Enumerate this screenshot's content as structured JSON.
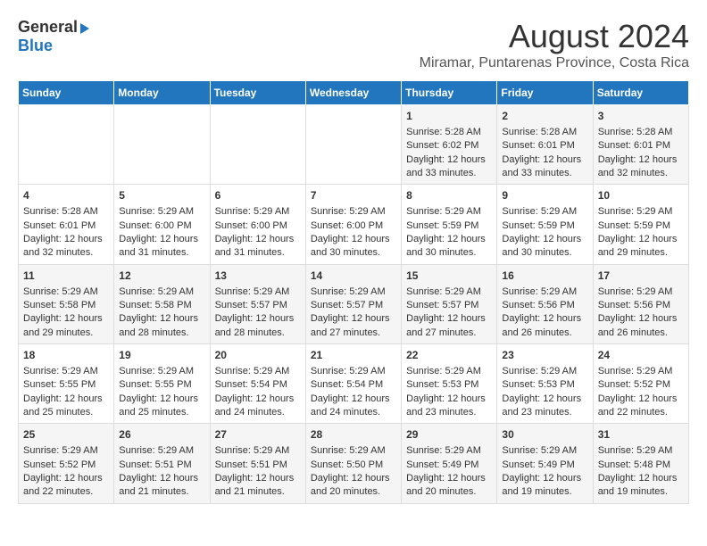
{
  "header": {
    "logo_general": "General",
    "logo_blue": "Blue",
    "month_year": "August 2024",
    "location": "Miramar, Puntarenas Province, Costa Rica"
  },
  "days_of_week": [
    "Sunday",
    "Monday",
    "Tuesday",
    "Wednesday",
    "Thursday",
    "Friday",
    "Saturday"
  ],
  "weeks": [
    [
      {
        "day": "",
        "content": ""
      },
      {
        "day": "",
        "content": ""
      },
      {
        "day": "",
        "content": ""
      },
      {
        "day": "",
        "content": ""
      },
      {
        "day": "1",
        "content": "Sunrise: 5:28 AM\nSunset: 6:02 PM\nDaylight: 12 hours and 33 minutes."
      },
      {
        "day": "2",
        "content": "Sunrise: 5:28 AM\nSunset: 6:01 PM\nDaylight: 12 hours and 33 minutes."
      },
      {
        "day": "3",
        "content": "Sunrise: 5:28 AM\nSunset: 6:01 PM\nDaylight: 12 hours and 32 minutes."
      }
    ],
    [
      {
        "day": "4",
        "content": "Sunrise: 5:28 AM\nSunset: 6:01 PM\nDaylight: 12 hours and 32 minutes."
      },
      {
        "day": "5",
        "content": "Sunrise: 5:29 AM\nSunset: 6:00 PM\nDaylight: 12 hours and 31 minutes."
      },
      {
        "day": "6",
        "content": "Sunrise: 5:29 AM\nSunset: 6:00 PM\nDaylight: 12 hours and 31 minutes."
      },
      {
        "day": "7",
        "content": "Sunrise: 5:29 AM\nSunset: 6:00 PM\nDaylight: 12 hours and 30 minutes."
      },
      {
        "day": "8",
        "content": "Sunrise: 5:29 AM\nSunset: 5:59 PM\nDaylight: 12 hours and 30 minutes."
      },
      {
        "day": "9",
        "content": "Sunrise: 5:29 AM\nSunset: 5:59 PM\nDaylight: 12 hours and 30 minutes."
      },
      {
        "day": "10",
        "content": "Sunrise: 5:29 AM\nSunset: 5:59 PM\nDaylight: 12 hours and 29 minutes."
      }
    ],
    [
      {
        "day": "11",
        "content": "Sunrise: 5:29 AM\nSunset: 5:58 PM\nDaylight: 12 hours and 29 minutes."
      },
      {
        "day": "12",
        "content": "Sunrise: 5:29 AM\nSunset: 5:58 PM\nDaylight: 12 hours and 28 minutes."
      },
      {
        "day": "13",
        "content": "Sunrise: 5:29 AM\nSunset: 5:57 PM\nDaylight: 12 hours and 28 minutes."
      },
      {
        "day": "14",
        "content": "Sunrise: 5:29 AM\nSunset: 5:57 PM\nDaylight: 12 hours and 27 minutes."
      },
      {
        "day": "15",
        "content": "Sunrise: 5:29 AM\nSunset: 5:57 PM\nDaylight: 12 hours and 27 minutes."
      },
      {
        "day": "16",
        "content": "Sunrise: 5:29 AM\nSunset: 5:56 PM\nDaylight: 12 hours and 26 minutes."
      },
      {
        "day": "17",
        "content": "Sunrise: 5:29 AM\nSunset: 5:56 PM\nDaylight: 12 hours and 26 minutes."
      }
    ],
    [
      {
        "day": "18",
        "content": "Sunrise: 5:29 AM\nSunset: 5:55 PM\nDaylight: 12 hours and 25 minutes."
      },
      {
        "day": "19",
        "content": "Sunrise: 5:29 AM\nSunset: 5:55 PM\nDaylight: 12 hours and 25 minutes."
      },
      {
        "day": "20",
        "content": "Sunrise: 5:29 AM\nSunset: 5:54 PM\nDaylight: 12 hours and 24 minutes."
      },
      {
        "day": "21",
        "content": "Sunrise: 5:29 AM\nSunset: 5:54 PM\nDaylight: 12 hours and 24 minutes."
      },
      {
        "day": "22",
        "content": "Sunrise: 5:29 AM\nSunset: 5:53 PM\nDaylight: 12 hours and 23 minutes."
      },
      {
        "day": "23",
        "content": "Sunrise: 5:29 AM\nSunset: 5:53 PM\nDaylight: 12 hours and 23 minutes."
      },
      {
        "day": "24",
        "content": "Sunrise: 5:29 AM\nSunset: 5:52 PM\nDaylight: 12 hours and 22 minutes."
      }
    ],
    [
      {
        "day": "25",
        "content": "Sunrise: 5:29 AM\nSunset: 5:52 PM\nDaylight: 12 hours and 22 minutes."
      },
      {
        "day": "26",
        "content": "Sunrise: 5:29 AM\nSunset: 5:51 PM\nDaylight: 12 hours and 21 minutes."
      },
      {
        "day": "27",
        "content": "Sunrise: 5:29 AM\nSunset: 5:51 PM\nDaylight: 12 hours and 21 minutes."
      },
      {
        "day": "28",
        "content": "Sunrise: 5:29 AM\nSunset: 5:50 PM\nDaylight: 12 hours and 20 minutes."
      },
      {
        "day": "29",
        "content": "Sunrise: 5:29 AM\nSunset: 5:49 PM\nDaylight: 12 hours and 20 minutes."
      },
      {
        "day": "30",
        "content": "Sunrise: 5:29 AM\nSunset: 5:49 PM\nDaylight: 12 hours and 19 minutes."
      },
      {
        "day": "31",
        "content": "Sunrise: 5:29 AM\nSunset: 5:48 PM\nDaylight: 12 hours and 19 minutes."
      }
    ]
  ]
}
